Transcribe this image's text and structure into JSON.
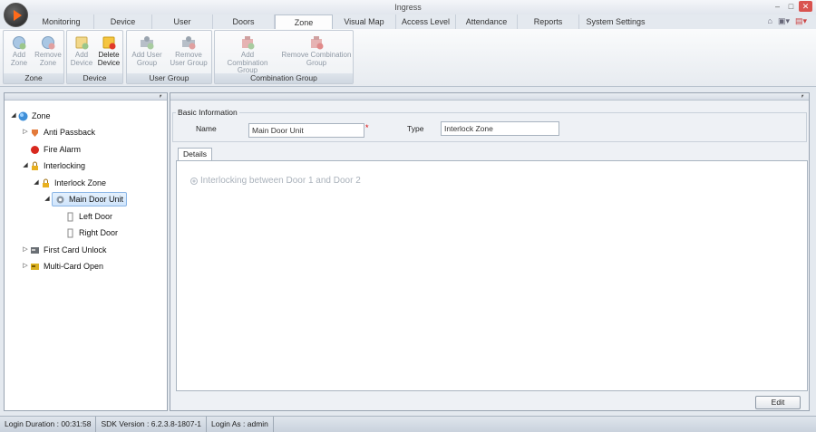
{
  "window": {
    "title": "Ingress"
  },
  "tabs": [
    {
      "label": "Monitoring"
    },
    {
      "label": "Device"
    },
    {
      "label": "User"
    },
    {
      "label": "Doors"
    },
    {
      "label": "Zone",
      "active": true
    },
    {
      "label": "Visual Map"
    },
    {
      "label": "Access Level"
    },
    {
      "label": "Attendance"
    },
    {
      "label": "Reports"
    },
    {
      "label": "System Settings"
    }
  ],
  "ribbon": {
    "zone": {
      "label": "Zone",
      "add": "Add Zone",
      "remove": "Remove Zone"
    },
    "device": {
      "label": "Device",
      "add": "Add Device",
      "delete": "Delete Device"
    },
    "user_group": {
      "label": "User Group",
      "add": "Add User Group",
      "remove": "Remove User Group"
    },
    "combination_group": {
      "label": "Combination Group",
      "add": "Add Combination Group",
      "remove": "Remove Combination Group"
    }
  },
  "tree": {
    "root": "Zone",
    "anti_passback": "Anti Passback",
    "fire_alarm": "Fire Alarm",
    "interlocking": "Interlocking",
    "interlock_zone": "Interlock Zone",
    "main_door_unit": "Main Door Unit",
    "left_door": "Left Door",
    "right_door": "Right Door",
    "first_card_unlock": "First Card Unlock",
    "multi_card_open": "Multi-Card Open"
  },
  "basic_info": {
    "legend": "Basic Information",
    "name_label": "Name",
    "name_value": "Main Door Unit",
    "required_mark": "*",
    "type_label": "Type",
    "type_value": "Interlock Zone"
  },
  "details": {
    "tab_label": "Details",
    "option_text": "Interlocking between Door 1 and Door 2"
  },
  "edit_button": "Edit",
  "status": {
    "login_duration": "Login Duration : 00:31:58",
    "sdk_version": "SDK Version : 6.2.3.8-1807-1",
    "login_as": "Login As : admin"
  },
  "colors": {
    "accent": "#ff6a1a",
    "selection": "#cfe4fb"
  }
}
